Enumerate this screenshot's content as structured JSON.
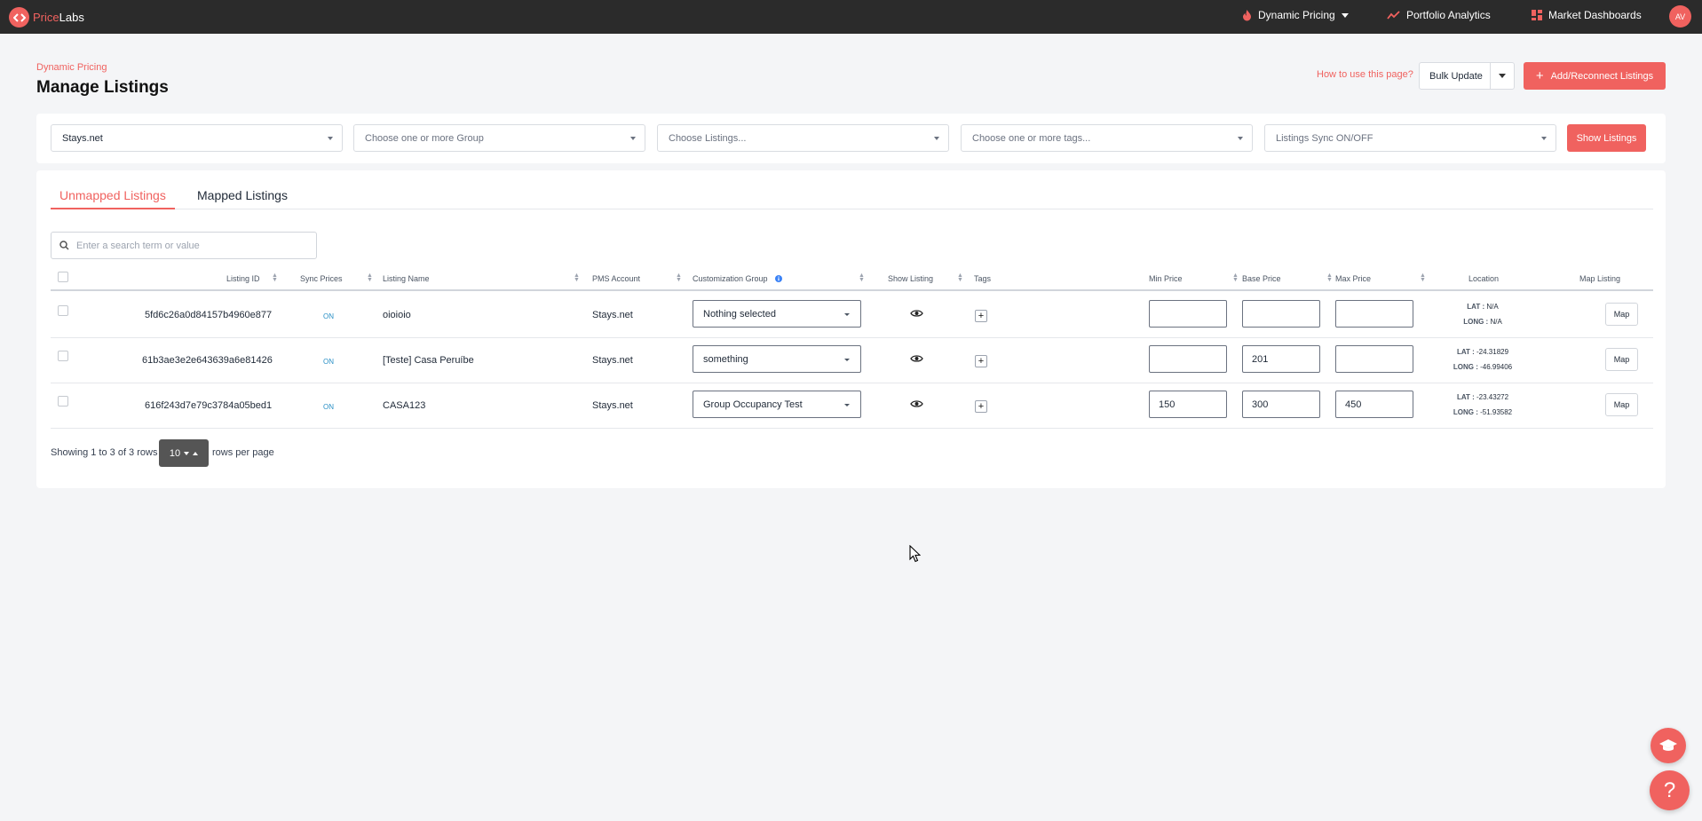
{
  "nav": {
    "logo_part1": "Price",
    "logo_part2": "Labs",
    "dynamic_pricing": "Dynamic Pricing",
    "portfolio_analytics": "Portfolio Analytics",
    "market_dashboards": "Market Dashboards",
    "avatar_initials": "AV"
  },
  "header": {
    "breadcrumb": "Dynamic Pricing",
    "title": "Manage Listings",
    "how_to": "How to use this page?",
    "bulk_update": "Bulk Update",
    "add_reconnect": "Add/Reconnect Listings"
  },
  "filters": {
    "pms": "Stays.net",
    "group_placeholder": "Choose one or more Group",
    "listings_placeholder": "Choose Listings...",
    "tags_placeholder": "Choose one or more tags...",
    "sync_placeholder": "Listings Sync ON/OFF",
    "show_listings": "Show Listings"
  },
  "tabs": {
    "unmapped": "Unmapped Listings",
    "mapped": "Mapped Listings"
  },
  "search": {
    "placeholder": "Enter a search term or value"
  },
  "columns": {
    "listing_id": "Listing ID",
    "sync_prices": "Sync Prices",
    "listing_name": "Listing Name",
    "pms_account": "PMS Account",
    "customization_group": "Customization Group",
    "show_listing": "Show Listing",
    "tags": "Tags",
    "min_price": "Min Price",
    "base_price": "Base Price",
    "max_price": "Max Price",
    "location": "Location",
    "map_listing": "Map Listing"
  },
  "rows": [
    {
      "id": "5fd6c26a0d84157b4960e877",
      "sync": "ON",
      "name": "oioioio",
      "pms": "Stays.net",
      "group": "Nothing selected",
      "min": "",
      "base": "",
      "max": "",
      "lat_label": "LAT :",
      "lat": "N/A",
      "long_label": "LONG :",
      "long": "N/A",
      "map": "Map"
    },
    {
      "id": "61b3ae3e2e643639a6e81426",
      "sync": "ON",
      "name": "[Teste] Casa Peruíbe",
      "pms": "Stays.net",
      "group": "something",
      "min": "",
      "base": "201",
      "max": "",
      "lat_label": "LAT :",
      "lat": "-24.31829",
      "long_label": "LONG :",
      "long": "-46.99406",
      "map": "Map"
    },
    {
      "id": "616f243d7e79c3784a05bed1",
      "sync": "ON",
      "name": "CASA123",
      "pms": "Stays.net",
      "group": "Group Occupancy Test",
      "min": "150",
      "base": "300",
      "max": "450",
      "lat_label": "LAT :",
      "lat": "-23.43272",
      "long_label": "LONG :",
      "long": "-51.93582",
      "map": "Map"
    }
  ],
  "pagination": {
    "showing": "Showing 1 to 3 of 3 rows",
    "per_page_value": "10",
    "rows_per_page": "rows per page"
  },
  "colors": {
    "accent": "#f0625f",
    "nav_bg": "#2b2b2b",
    "sync_on": "#2a90c6"
  }
}
